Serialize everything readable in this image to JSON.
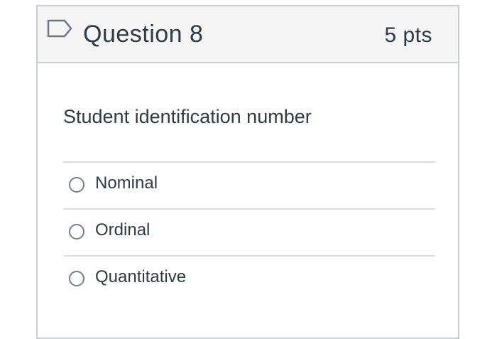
{
  "question": {
    "title": "Question 8",
    "points": "5 pts",
    "flag_icon": "flag-bookmark-icon",
    "text": "Student identification number"
  },
  "answers": [
    {
      "label": "Nominal",
      "selected": false
    },
    {
      "label": "Ordinal",
      "selected": false
    },
    {
      "label": "Quantitative",
      "selected": false
    }
  ],
  "colors": {
    "text": "#2d3b45",
    "border": "#c7cdd1",
    "header_bg": "#f5f5f5",
    "flag_accent": "#2d3b45",
    "radio_border": "#73818a"
  }
}
